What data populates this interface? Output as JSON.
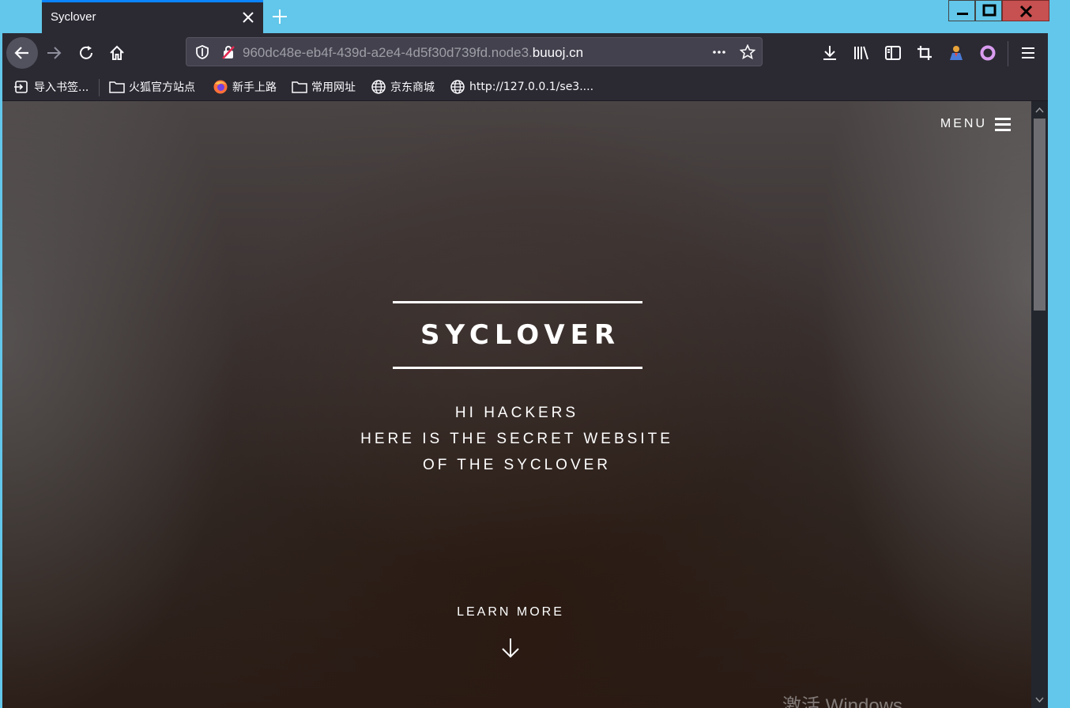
{
  "browser": {
    "tab": {
      "title": "Syclover"
    },
    "url": {
      "prefix": "960dc48e-eb4f-439d-a2e4-4d5f30d739fd.node3.",
      "domain": "buuoj.cn"
    },
    "bookmarks": [
      {
        "label": "导入书签...",
        "icon": "import-icon"
      },
      {
        "label": "火狐官方站点",
        "icon": "folder-icon"
      },
      {
        "label": "新手上路",
        "icon": "firefox-icon"
      },
      {
        "label": "常用网址",
        "icon": "folder-icon"
      },
      {
        "label": "京东商城",
        "icon": "globe-icon"
      },
      {
        "label": "http://127.0.0.1/se3....",
        "icon": "globe-icon"
      }
    ],
    "accent_color": "#0a84ff",
    "window_close_color": "#c75050"
  },
  "page": {
    "menu_label": "MENU",
    "brand": "SYCLOVER",
    "tagline": [
      "HI HACKERS",
      "HERE IS THE SECRET WEBSITE",
      "OF THE SYCLOVER"
    ],
    "learn_more": "LEARN MORE",
    "watermark": "激活 Windows"
  }
}
